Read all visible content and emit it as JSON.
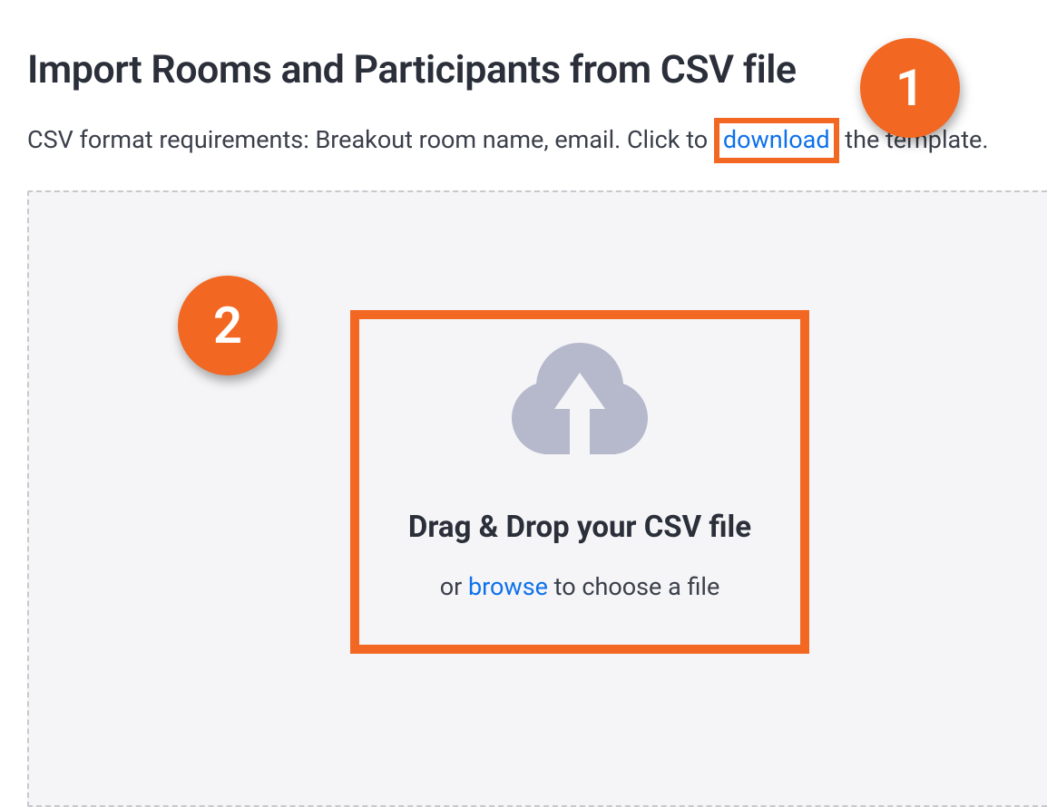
{
  "header": {
    "title": "Import Rooms and Participants from CSV file"
  },
  "instructions": {
    "prefix": "CSV format requirements: Breakout room name, email. Click to ",
    "download_label": "download",
    "suffix": " the template."
  },
  "dropzone": {
    "heading": "Drag & Drop your CSV file",
    "sub_prefix": "or ",
    "browse_label": "browse",
    "sub_suffix": " to choose a file"
  },
  "annotations": {
    "badge1": "1",
    "badge2": "2"
  }
}
